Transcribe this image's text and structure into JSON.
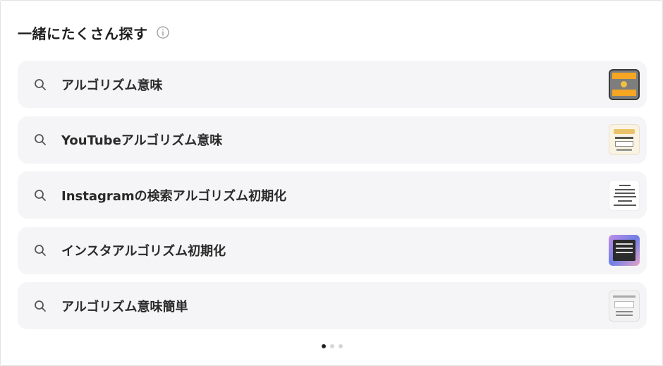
{
  "header": {
    "title": "一緒にたくさん探す",
    "info_icon": "info-circle-icon"
  },
  "suggestions": [
    {
      "label": "アルゴリズム意味",
      "icon": "search-icon"
    },
    {
      "label": "YouTubeアルゴリズム意味",
      "icon": "search-icon"
    },
    {
      "label": "Instagramの検索アルゴリズム初期化",
      "icon": "search-icon"
    },
    {
      "label": "インスタアルゴリズム初期化",
      "icon": "search-icon"
    },
    {
      "label": "アルゴリズム意味簡単",
      "icon": "search-icon"
    }
  ],
  "pager": {
    "total": 3,
    "active_index": 0
  },
  "colors": {
    "item_background": "#f5f5f7",
    "text": "#2a2a2a",
    "active_dot": "#222222",
    "inactive_dot": "#d6d6d6"
  }
}
